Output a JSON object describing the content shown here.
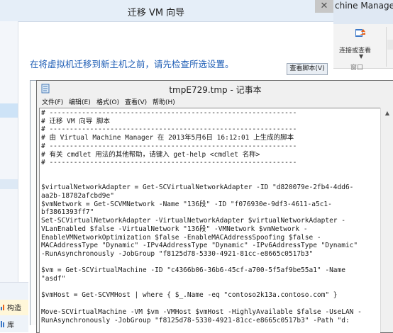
{
  "wizard": {
    "title": "迁移 VM 向导",
    "close_glyph": "✕",
    "prompt": "在将虚拟机迁移到新主机之前，请先检查所选设置。",
    "view_script_label": "查看脚本(V)"
  },
  "vmm": {
    "title": "chine Manager",
    "ribbon_label": "连接或查看",
    "ribbon_group": "窗口"
  },
  "sidebar": {
    "build_label": "构造",
    "library_label": "库"
  },
  "notepad": {
    "title": "tmpE729.tmp - 记事本",
    "menu": [
      "文件(F)",
      "编辑(E)",
      "格式(O)",
      "查看(V)",
      "帮助(H)"
    ],
    "content": "# -------------------------------------------------------------\n# 迁移 VM 向导 脚本\n# -------------------------------------------------------------\n# 由 Virtual Machine Manager 在 2013年5月6日 16:12:01 上生成的脚本\n# -------------------------------------------------------------\n# 有关 cmdlet 用法的其他帮助，请键入 get-help <cmdlet 名称>\n# -------------------------------------------------------------\n\n\n$virtualNetworkAdapter = Get-SCVirtualNetworkAdapter -ID \"d820079e-2fb4-4dd6-\naa2b-18782afcbd9e\"\n$vmNetwork = Get-SCVMNetwork -Name \"136段\" -ID \"f076930e-9df3-4611-a5c1-\nbf3861393ff7\"\nSet-SCVirtualNetworkAdapter -VirtualNetworkAdapter $virtualNetworkAdapter -\nVLanEnabled $false -VirtualNetwork \"136段\" -VMNetwork $vmNetwork -\nEnableVMNetworkOptimization $false -EnableMACAddressSpoofing $false -\nMACAddressType \"Dynamic\" -IPv4AddressType \"Dynamic\" -IPv6AddressType \"Dynamic\"\n-RunAsynchronously -JobGroup \"f8125d78-5330-4921-81cc-e8665c0517b3\"\n\n$vm = Get-SCVirtualMachine -ID \"c4366b06-36b6-45cf-a700-5f5af9be55a1\" -Name\n\"asdf\"\n\n$vmHost = Get-SCVMHost | where { $_.Name -eq \"contoso2k13a.contoso.com\" }\n\nMove-SCVirtualMachine -VM $vm -VMHost $vmHost -HighlyAvailable $false -UseLAN -\nRunAsynchronously -JobGroup \"f8125d78-5330-4921-81cc-e8665c0517b3\" -Path \"d:"
  },
  "colors": {
    "prompt_blue": "#1c5cb5",
    "ribbon_icon_orange": "#e8641e",
    "ribbon_icon_blue": "#3b77c7"
  }
}
